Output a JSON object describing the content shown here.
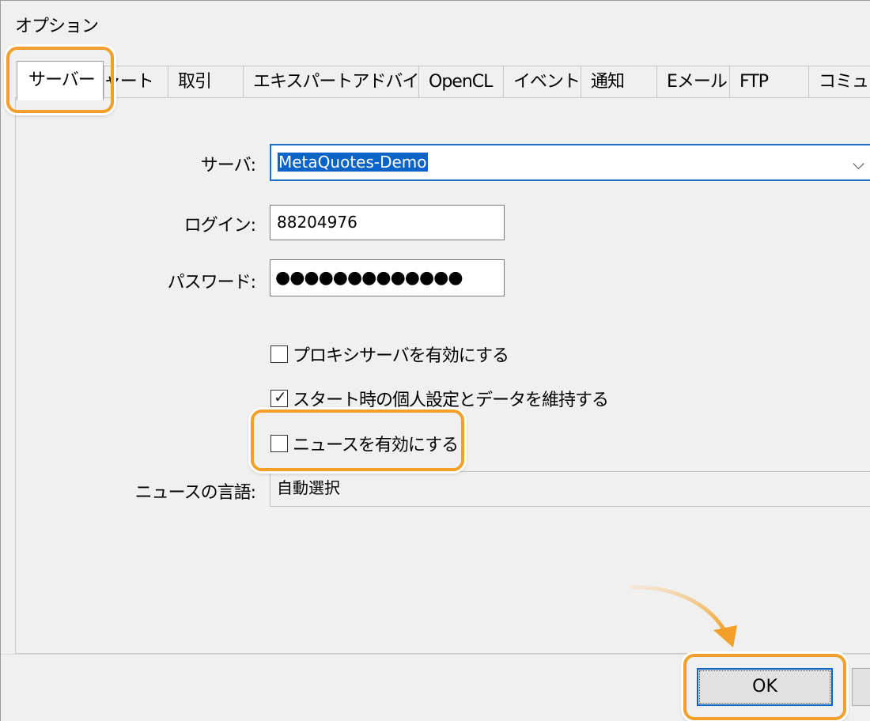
{
  "window": {
    "title": "オプション"
  },
  "tabs": [
    {
      "label": "サーバー"
    },
    {
      "label": "チャート"
    },
    {
      "label": "取引"
    },
    {
      "label": "エキスパートアドバイザ"
    },
    {
      "label": "OpenCL"
    },
    {
      "label": "イベント"
    },
    {
      "label": "通知"
    },
    {
      "label": "Eメール"
    },
    {
      "label": "FTP"
    },
    {
      "label": "コミュニティ"
    }
  ],
  "server": {
    "server_label": "サーバ:",
    "server_value": "MetaQuotes-Demo",
    "login_label": "ログイン:",
    "login_value": "88204976",
    "password_label": "パスワード:",
    "password_value": "●●●●●●●●●●●●●",
    "proxy_label": "プロキシサーバを有効にする",
    "proxy_checked": false,
    "keep_settings_label": "スタート時の個人設定とデータを維持する",
    "keep_settings_checked": true,
    "news_label": "ニュースを有効にする",
    "news_checked": false,
    "news_lang_label": "ニュースの言語:",
    "news_lang_value": "自動選択"
  },
  "buttons": {
    "ok": "OK"
  },
  "colors": {
    "highlight": "#f2a02a",
    "selection": "#0a64c8"
  },
  "icons": {
    "dropdown": "chevron-down-icon",
    "check": "checkmark-icon",
    "arrow": "curved-arrow-icon"
  }
}
